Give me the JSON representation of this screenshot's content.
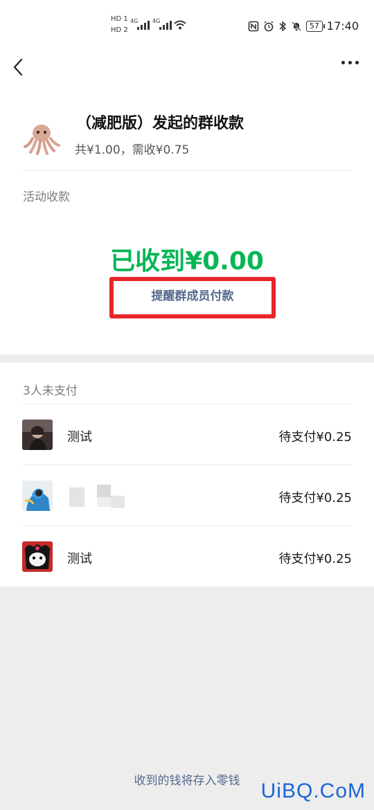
{
  "status_bar": {
    "sim1": "HD 1",
    "sim2": "HD 2",
    "net1": "4G",
    "net2": "4G",
    "battery": "57",
    "time": "17:40",
    "icons": [
      "nfc-icon",
      "alarm-icon",
      "bluetooth-icon",
      "mute-icon"
    ]
  },
  "header": {
    "back_icon": "chevron-left-icon",
    "more_icon": "more-dots-icon"
  },
  "group": {
    "title": "（减肥版）发起的群收款",
    "subtitle": "共¥1.00，需收¥0.75"
  },
  "activity": {
    "label": "活动收款",
    "received": "已收到¥0.00",
    "remind_button": "提醒群成员付款"
  },
  "unpaid": {
    "label": "3人未支付",
    "members": [
      {
        "name": "测试",
        "status": "待支付¥0.25"
      },
      {
        "name": "",
        "status": "待支付¥0.25"
      },
      {
        "name": "测试",
        "status": "待支付¥0.25"
      }
    ]
  },
  "footer": {
    "note": "收到的钱将存入零钱"
  },
  "watermark": "UiBQ.CoM",
  "colors": {
    "accent_green": "#07b655",
    "link_blue": "#55698c",
    "highlight_red": "#e8262a",
    "watermark_blue": "#1a64d8"
  }
}
